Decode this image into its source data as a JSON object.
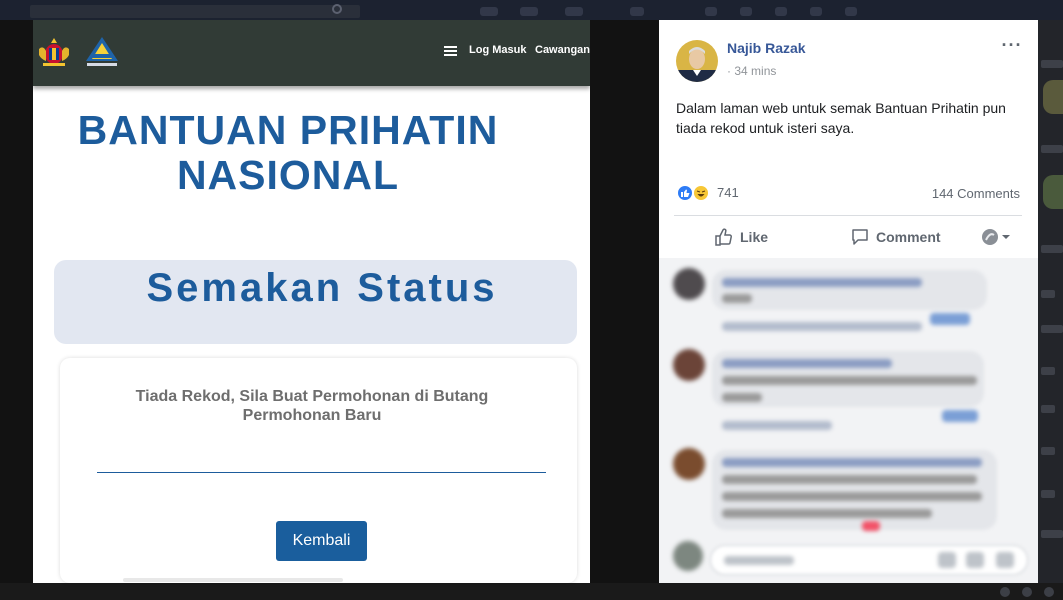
{
  "lhdn_page": {
    "nav": {
      "login": "Log Masuk",
      "branch": "Cawangan"
    },
    "heading": "BANTUAN PRIHATIN NASIONAL",
    "status_title": "Semakan Status",
    "result_message": "Tiada Rekod, Sila Buat Permohonan di Butang Permohonan Baru",
    "back_button": "Kembali",
    "colors": {
      "header": "#313b36",
      "primary": "#1d5c9c",
      "banner": "#e2e7f1"
    }
  },
  "post": {
    "author": "Najib Razak",
    "timestamp": "34 mins",
    "text": "Dalam laman web untuk semak Bantuan Prihatin pun tiada rekod untuk isteri saya.",
    "reactions": {
      "icons": [
        "like-icon",
        "haha-icon"
      ],
      "count": "741"
    },
    "comments_count": "144 Comments",
    "actions": {
      "like": "Like",
      "comment": "Comment"
    }
  }
}
